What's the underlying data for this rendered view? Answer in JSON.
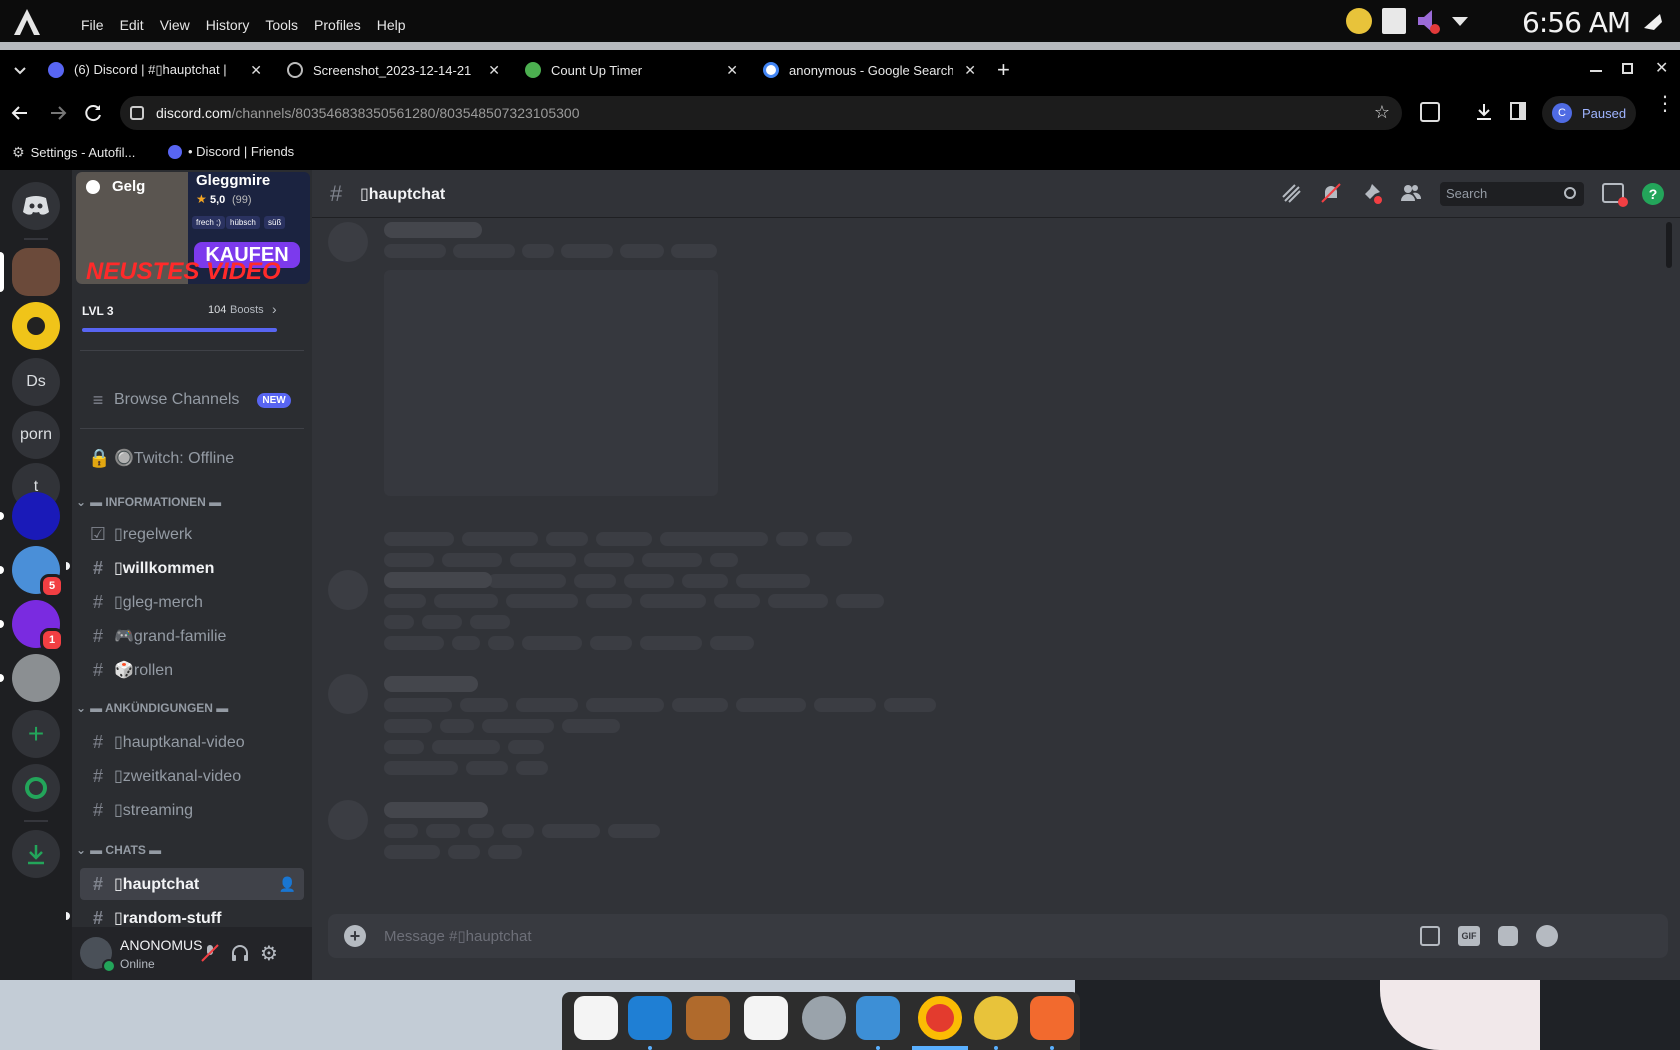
{
  "os": {
    "menu": [
      "File",
      "Edit",
      "View",
      "History",
      "Tools",
      "Profiles",
      "Help"
    ],
    "clock": "6:56 AM"
  },
  "browser": {
    "tabs": [
      {
        "title": "(6) Discord | #▯hauptchat |"
      },
      {
        "title": "Screenshot_2023-12-14-21"
      },
      {
        "title": "Count Up Timer"
      },
      {
        "title": "anonymous - Google Search"
      }
    ],
    "url_host": "discord.com",
    "url_path": "/channels/803546838350561280/803548507323105300",
    "profile_initial": "C",
    "profile_status": "Paused",
    "bookmarks": [
      {
        "label": "Settings - Autofil..."
      },
      {
        "label": "• Discord | Friends"
      }
    ]
  },
  "guilds": {
    "items": [
      {
        "label": "Ds"
      },
      {
        "label": "porn"
      },
      {
        "label": "t"
      }
    ],
    "badges": [
      "5",
      "1"
    ]
  },
  "server": {
    "banner_name": "Gelg",
    "banner_user": "Gleggmire",
    "banner_rating": "5,0",
    "banner_count": "(99)",
    "banner_tags": [
      "frech ;)",
      "hübsch",
      "süß"
    ],
    "banner_buy": "KAUFEN",
    "banner_headline": "NEUSTES VIDEO",
    "level": "LVL 3",
    "boosts": "104",
    "boosts_label": "Boosts",
    "browse_channels": "Browse Channels",
    "new_badge": "NEW",
    "twitch": "🔘Twitch: Offline",
    "categories": [
      {
        "label": "▬ INFORMATIONEN ▬"
      },
      {
        "label": "▬ ANKÜNDIGUNGEN ▬"
      },
      {
        "label": "▬ CHATS ▬"
      }
    ],
    "channels": [
      {
        "label": "▯regelwerk"
      },
      {
        "label": "▯willkommen"
      },
      {
        "label": "▯gleg-merch"
      },
      {
        "label": "🎮grand-familie"
      },
      {
        "label": "🎲rollen"
      },
      {
        "label": "▯hauptkanal-video"
      },
      {
        "label": "▯zweitkanal-video"
      },
      {
        "label": "▯streaming"
      },
      {
        "label": "▯hauptchat"
      },
      {
        "label": "▯random-stuff"
      }
    ]
  },
  "user": {
    "name": "ANONOMUS",
    "status": "Online"
  },
  "main": {
    "channel_title": "▯hauptchat",
    "search_placeholder": "Search",
    "message_placeholder": "Message #▯hauptchat"
  },
  "colors": {
    "discord_bg": "#313338",
    "sidebar_bg": "#2b2d31",
    "guild_bg": "#1e1f22",
    "accent": "#5865f2",
    "online": "#23a55a",
    "danger": "#f23f43"
  }
}
